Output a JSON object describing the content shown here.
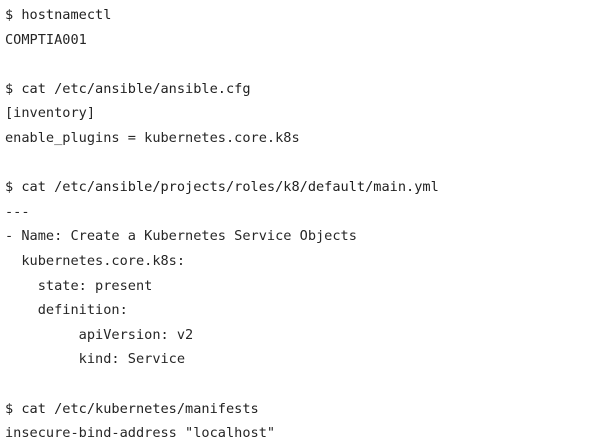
{
  "terminal": {
    "blocks": [
      {
        "command": "$ hostnamectl",
        "output": [
          "COMPTIA001"
        ]
      },
      {
        "command": "$ cat /etc/ansible/ansible.cfg",
        "output": [
          "[inventory]",
          "enable_plugins = kubernetes.core.k8s"
        ]
      },
      {
        "command": "$ cat /etc/ansible/projects/roles/k8/default/main.yml",
        "output": [
          "---",
          "- Name: Create a Kubernetes Service Objects",
          "  kubernetes.core.k8s:",
          "    state: present",
          "    definition:",
          "         apiVersion: v2",
          "         kind: Service"
        ]
      },
      {
        "command": "$ cat /etc/kubernetes/manifests",
        "output": [
          "insecure-bind-address \"localhost\""
        ]
      }
    ]
  }
}
